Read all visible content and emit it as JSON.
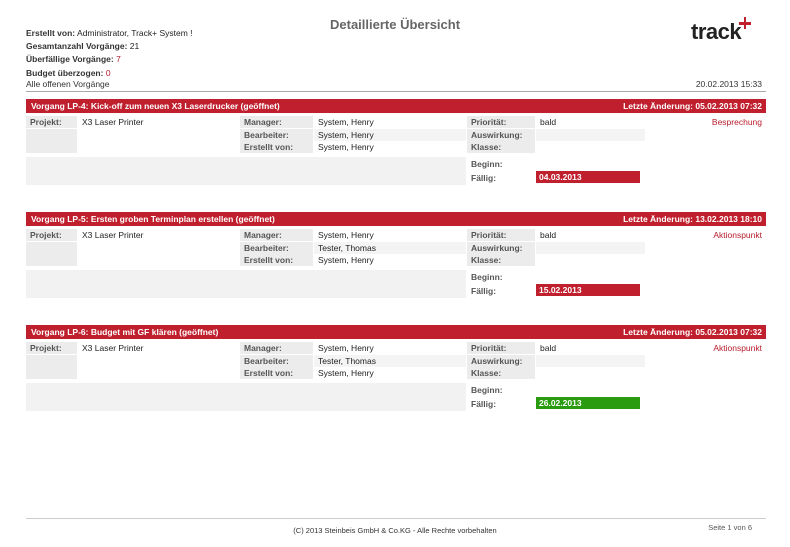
{
  "title": "Detaillierte Übersicht",
  "logo": {
    "text": "track"
  },
  "header": {
    "created_by_label": "Erstellt von:",
    "created_by_value": "Administrator, Track+ System !",
    "total_label": "Gesamtanzahl Vorgänge:",
    "total_value": "21",
    "overdue_label": "Überfällige Vorgänge:",
    "overdue_value": "7",
    "budget_label": "Budget überzogen:",
    "budget_value": "0"
  },
  "filter": "Alle offenen Vorgänge",
  "report_date": "20.02.2013 15:33",
  "labels": {
    "project": "Projekt:",
    "manager": "Manager:",
    "responsible": "Bearbeiter:",
    "originator": "Erstellt von:",
    "priority": "Priorität:",
    "severity": "Auswirkung:",
    "class": "Klasse:",
    "start": "Beginn:",
    "due": "Fällig:"
  },
  "issues": [
    {
      "header": "Vorgang LP-4: Kick-off zum neuen X3 Laserdrucker  (geöffnet)",
      "last_change": "Letzte Änderung: 05.02.2013 07:32",
      "project": "X3 Laser Printer",
      "manager": "System, Henry",
      "responsible": "System, Henry",
      "originator": "System, Henry",
      "priority": "bald",
      "type": "Besprechung",
      "due": "04.03.2013",
      "due_color": "#c0202e"
    },
    {
      "header": "Vorgang LP-5: Ersten groben Terminplan erstellen  (geöffnet)",
      "last_change": "Letzte Änderung: 13.02.2013 18:10",
      "project": "X3 Laser Printer",
      "manager": "System, Henry",
      "responsible": "Tester, Thomas",
      "originator": "System, Henry",
      "priority": "bald",
      "type": "Aktionspunkt",
      "due": "15.02.2013",
      "due_color": "#c0202e"
    },
    {
      "header": "Vorgang LP-6: Budget mit GF klären  (geöffnet)",
      "last_change": "Letzte Änderung: 05.02.2013 07:32",
      "project": "X3 Laser Printer",
      "manager": "System, Henry",
      "responsible": "Tester, Thomas",
      "originator": "System, Henry",
      "priority": "bald",
      "type": "Aktionspunkt",
      "due": "26.02.2013",
      "due_color": "#2a9a0e"
    }
  ],
  "footer": {
    "copyright": "(C) 2013 Steinbeis GmbH & Co.KG - Alle Rechte vorbehalten",
    "page": "Seite 1 von 6"
  },
  "colors": {
    "accent": "#c0202e",
    "ok": "#2a9a0e"
  }
}
